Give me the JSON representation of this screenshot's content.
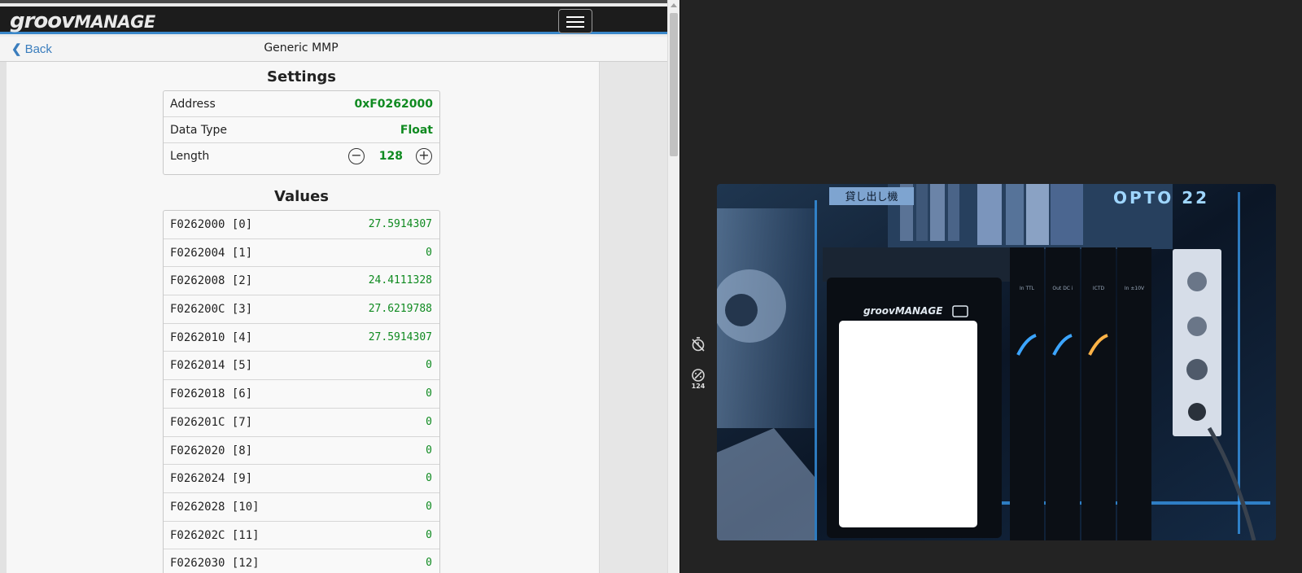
{
  "app": {
    "logo_part1": "groov",
    "logo_part2": "MANAGE"
  },
  "nav": {
    "back_label": "Back",
    "title": "Generic MMP"
  },
  "settings": {
    "heading": "Settings",
    "address_label": "Address",
    "address_value": "0xF0262000",
    "datatype_label": "Data Type",
    "datatype_value": "Float",
    "length_label": "Length",
    "length_value": "128"
  },
  "values": {
    "heading": "Values",
    "rows": [
      {
        "label": "F0262000 [0]",
        "value": "27.5914307"
      },
      {
        "label": "F0262004 [1]",
        "value": "0"
      },
      {
        "label": "F0262008 [2]",
        "value": "24.4111328"
      },
      {
        "label": "F026200C [3]",
        "value": "27.6219788"
      },
      {
        "label": "F0262010 [4]",
        "value": "27.5914307"
      },
      {
        "label": "F0262014 [5]",
        "value": "0"
      },
      {
        "label": "F0262018 [6]",
        "value": "0"
      },
      {
        "label": "F026201C [7]",
        "value": "0"
      },
      {
        "label": "F0262020 [8]",
        "value": "0"
      },
      {
        "label": "F0262024 [9]",
        "value": "0"
      },
      {
        "label": "F0262028 [10]",
        "value": "0"
      },
      {
        "label": "F026202C [11]",
        "value": "0"
      },
      {
        "label": "F0262030 [12]",
        "value": "0"
      }
    ]
  },
  "side_panel": {
    "stat_value": "124"
  },
  "camera": {
    "brand_text": "OPTO 22",
    "sign_text": "貸し出し機",
    "device_logo": "groovMANAGE",
    "module_labels": [
      "In TTL",
      "Out DC i",
      "ICTD",
      "In ±10V"
    ]
  },
  "colors": {
    "accent": "#3a87c9",
    "value_green": "#0f8a20",
    "topbar": "#1c1c1c"
  }
}
